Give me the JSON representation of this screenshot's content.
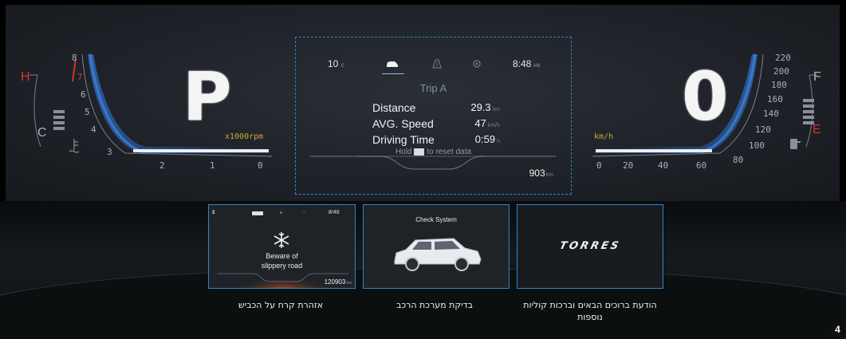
{
  "cluster": {
    "gear": "P",
    "speed": "0",
    "rpm_unit": "x1000rpm",
    "speed_unit": "km/h",
    "rpm_ticks": [
      "8",
      "7",
      "6",
      "5",
      "4",
      "3",
      "2",
      "1",
      "0"
    ],
    "speed_ticks_bottom": [
      "0",
      "20",
      "40",
      "60",
      "80",
      "100"
    ],
    "speed_ticks_right": [
      "120",
      "140",
      "160",
      "180",
      "200",
      "220"
    ],
    "temp_hot": "H",
    "temp_cold": "C",
    "fuel_full": "F",
    "fuel_empty": "E",
    "accent_red": "#d6332a",
    "accent_blue": "#2e86c8"
  },
  "info_panel": {
    "temperature": "10",
    "temperature_unit": "c",
    "clock_time": "8:48",
    "clock_ampm": "AM",
    "tabs": [
      "car-icon",
      "road-icon",
      "gear-icon"
    ],
    "trip_title": "Trip A",
    "rows": [
      {
        "label": "Distance",
        "value": "29.3",
        "unit": "km"
      },
      {
        "label": "AVG. Speed",
        "value": "47",
        "unit": "km/h"
      },
      {
        "label": "Driving Time",
        "value": "0:59",
        "unit": "h"
      }
    ],
    "hold_prefix": "Hold",
    "hold_suffix": "to reset data",
    "odometer": "903",
    "odometer_unit": "km"
  },
  "thumbs": {
    "ice": {
      "temperature": "1",
      "temperature_unit": "c",
      "clock_time": "8:48",
      "clock_ampm": "AM",
      "message_line1": "Beware of",
      "message_line2": "slippery road",
      "odometer": "120903",
      "odometer_unit": "km",
      "caption": "אזהרת קרח על הכביש"
    },
    "check": {
      "title": "Check System",
      "caption": "בדיקת מערכת הרכב"
    },
    "torres": {
      "logo_text": "TORRES",
      "caption_line1": "הודעת ברוכים הבאים וברכות קוליות",
      "caption_line2": "נוספות"
    }
  },
  "page_number": "4"
}
